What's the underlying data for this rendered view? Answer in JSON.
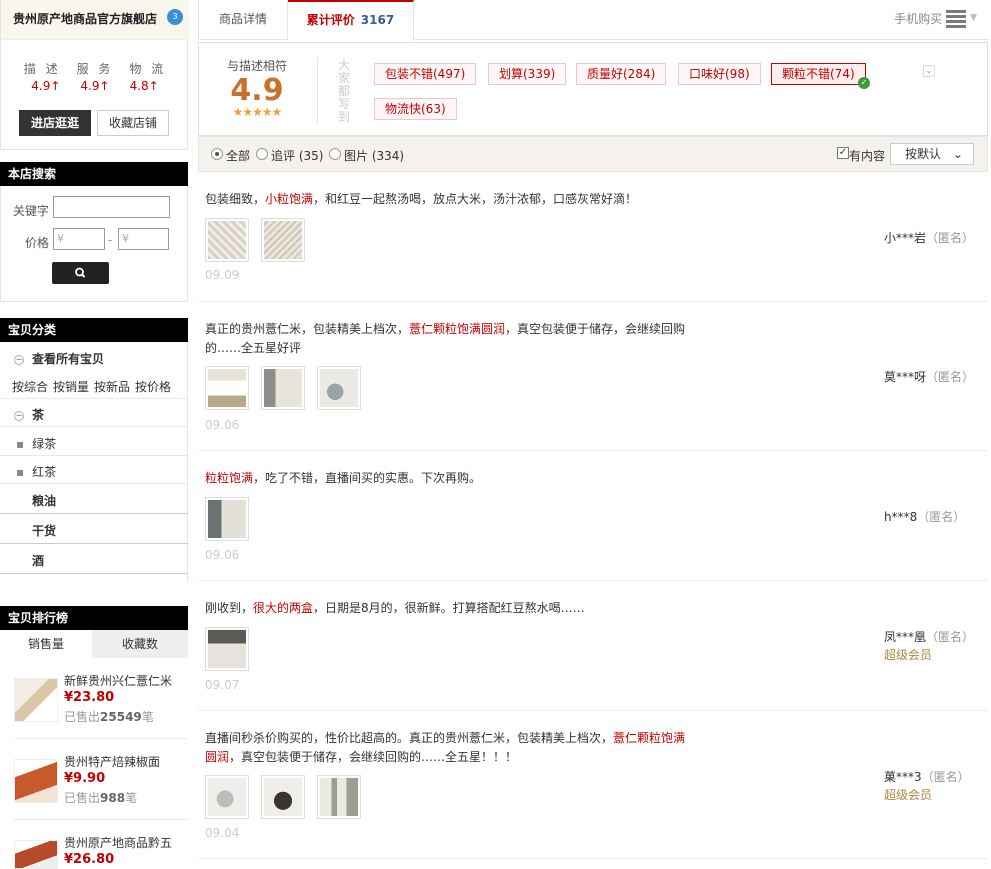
{
  "shop": {
    "name": "贵州原产地商品官方旗舰店",
    "badge": "3",
    "ratings_labels": [
      "描 述",
      "服 务",
      "物 流"
    ],
    "ratings_values": [
      "4.9↑",
      "4.9↑",
      "4.8↑"
    ],
    "enter_button": "进店逛逛",
    "favorite_button": "收藏店铺"
  },
  "store_search": {
    "title": "本店搜索",
    "keyword_label": "关键字",
    "price_label": "价格",
    "price_min_placeholder": "¥",
    "price_max_placeholder": "¥",
    "dash": "-"
  },
  "categories": {
    "title": "宝贝分类",
    "view_all": "查看所有宝贝",
    "sort_links": [
      "按综合",
      "按销量",
      "按新品",
      "按价格"
    ],
    "tea": "茶",
    "tea_items": [
      "绿茶",
      "红茶"
    ],
    "groups": [
      "粮油",
      "干货",
      "酒"
    ]
  },
  "ranking": {
    "title": "宝贝排行榜",
    "tab_sales": "销售量",
    "tab_favorites": "收藏数",
    "sold_prefix": "已售出",
    "sold_suffix": "笔",
    "items": [
      {
        "title": "新鲜贵州兴仁薏仁米",
        "price": "¥23.80",
        "sold": "25549"
      },
      {
        "title": "贵州特产焙辣椒面",
        "price": "¥9.90",
        "sold": "988"
      },
      {
        "title": "贵州原产地商品黔五",
        "price": "¥26.80",
        "sold": ""
      }
    ]
  },
  "tabs": {
    "details": "商品详情",
    "reviews": "累计评价",
    "review_count": "3167",
    "mobile_buy": "手机购买"
  },
  "summary": {
    "label": "与描述相符",
    "score": "4.9",
    "stars": "★★★★★",
    "vertical_text": "大家都写到",
    "tags": [
      "包装不错(497)",
      "划算(339)",
      "质量好(284)",
      "口味好(98)",
      "颗粒不错(74)",
      "物流快(63)"
    ]
  },
  "filters": {
    "all": "全部",
    "followup": "追评 (35)",
    "pictures": "图片 (334)",
    "has_content": "有内容",
    "sort": "按默认"
  },
  "reviews": [
    {
      "parts": [
        "包装细致，",
        "小粒饱满",
        "，和红豆一起熬汤喝，放点大米，汤汁浓郁，口感灰常好滴！"
      ],
      "date": "09.09",
      "user": "小***岩",
      "anon": "（匿名）",
      "vip": ""
    },
    {
      "parts": [
        "真正的贵州薏仁米，包装精美上档次，",
        "薏仁颗粒饱满圆润",
        "，真空包装便于储存，会继续回购的……全五星好评"
      ],
      "date": "09.06",
      "user": "莫***呀",
      "anon": "（匿名）",
      "vip": ""
    },
    {
      "parts": [
        "",
        "粒粒饱满",
        "，吃了不错，直播间买的实惠。下次再购。"
      ],
      "date": "09.06",
      "user": "h***8",
      "anon": "（匿名）",
      "vip": ""
    },
    {
      "parts": [
        "刚收到，",
        "很大的两盒",
        "，日期是8月的，很新鲜。打算搭配红豆熬水喝……"
      ],
      "date": "09.07",
      "user": "凤***凰",
      "anon": "（匿名）",
      "vip": "超级会员"
    },
    {
      "parts": [
        "直播间秒杀价购买的，性价比超高的。真正的贵州薏仁米，包装精美上档次，",
        "薏仁颗粒饱满圆润",
        "，真空包装便于储存，会继续回购的……全五星！！！"
      ],
      "date": "09.04",
      "user": "菓***3",
      "anon": "（匿名）",
      "vip": "超级会员"
    }
  ],
  "colors": {
    "accent": "#c40000",
    "score": "#c8702d",
    "link_blue": "#3c5a96",
    "vip": "#b08840"
  }
}
